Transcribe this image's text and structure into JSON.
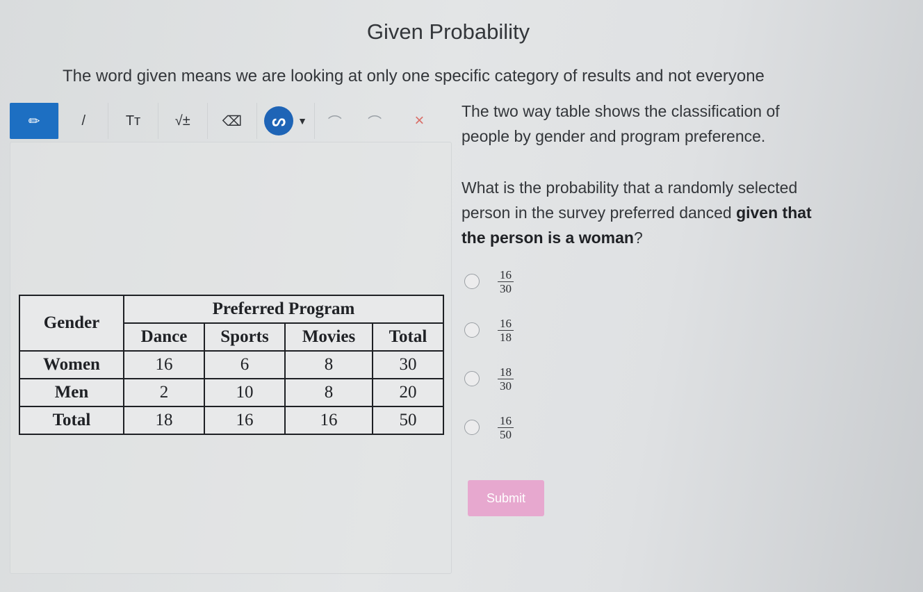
{
  "page": {
    "title": "Given Probability",
    "subtitle": "The word given means we are looking at only one specific category of results and not everyone"
  },
  "toolbar": {
    "tools": [
      {
        "icon": "pencil-icon",
        "glyph": "✏"
      },
      {
        "icon": "line-icon",
        "glyph": "/"
      },
      {
        "icon": "text-size-icon",
        "glyph": "Tт"
      },
      {
        "icon": "math-icon",
        "glyph": "√±"
      },
      {
        "icon": "eraser-icon",
        "glyph": "⌫"
      },
      {
        "icon": "color-picker-icon",
        "glyph": "ᔕ"
      },
      {
        "icon": "undo-icon",
        "glyph": "⌒"
      },
      {
        "icon": "redo-icon",
        "glyph": "⌒"
      },
      {
        "icon": "close-icon",
        "glyph": "×"
      }
    ],
    "colors": {
      "active": "#1d6fc2",
      "color_circle": "#1e64b6",
      "close": "#d9706a"
    }
  },
  "table": {
    "header": {
      "gender": "Gender",
      "preferred_program": "Preferred Program",
      "columns": [
        "Dance",
        "Sports",
        "Movies",
        "Total"
      ]
    },
    "rows": [
      {
        "label": "Women",
        "values": [
          "16",
          "6",
          "8",
          "30"
        ]
      },
      {
        "label": "Men",
        "values": [
          "2",
          "10",
          "8",
          "20"
        ]
      },
      {
        "label": "Total",
        "values": [
          "18",
          "16",
          "16",
          "50"
        ]
      }
    ]
  },
  "question": {
    "intro_line1": "The two way table shows the classification of",
    "intro_line2": "people by gender and program preference.",
    "prompt_line1": "What is the probability that a randomly selected",
    "prompt_line2_plain": "person in the survey preferred danced ",
    "prompt_line2_bold": "given that",
    "prompt_line3_bold": "the person is a woman",
    "prompt_end": "?"
  },
  "options": [
    {
      "num": "16",
      "den": "30"
    },
    {
      "num": "16",
      "den": "18"
    },
    {
      "num": "18",
      "den": "30"
    },
    {
      "num": "16",
      "den": "50"
    }
  ],
  "submit": {
    "label": "Submit",
    "color": "#e7a8cf"
  }
}
